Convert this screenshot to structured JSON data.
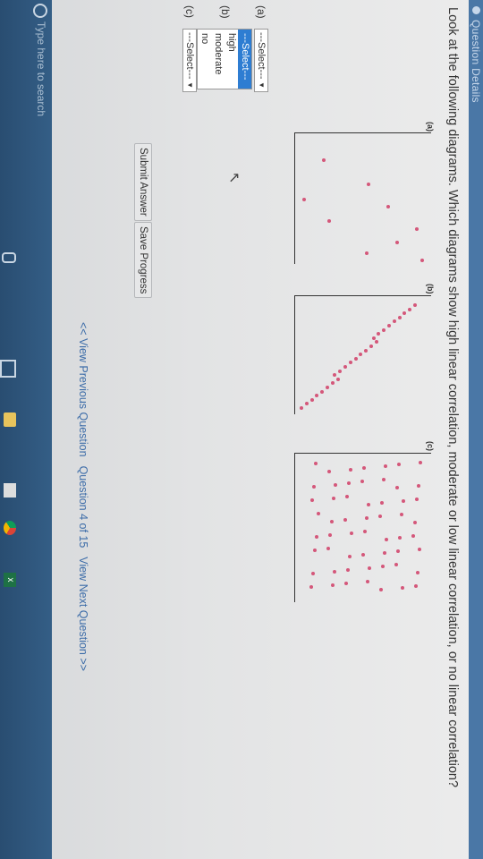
{
  "header": {
    "title": "Question Details"
  },
  "question": {
    "text": "Look at the following diagrams. Which diagrams show high linear correlation, moderate or low linear correlation, or no linear correlation?"
  },
  "diagrams": [
    {
      "label": "(a)"
    },
    {
      "label": "(b)"
    },
    {
      "label": "(c)"
    }
  ],
  "answers": {
    "rows": [
      {
        "letter": "(a)",
        "selected": "---Select---"
      },
      {
        "letter": "(b)"
      },
      {
        "letter": "(c)",
        "selected": "---Select---"
      }
    ],
    "dropdown_options": [
      "---Select---",
      "high",
      "moderate",
      "no"
    ]
  },
  "buttons": {
    "submit": "Submit Answer",
    "save": "Save Progress"
  },
  "nav": {
    "prev": "<< View Previous Question",
    "position": "Question 4 of 15",
    "next": "View Next Question >>"
  },
  "taskbar": {
    "search_placeholder": "Type here to search",
    "excel_label": "x"
  },
  "colors": {
    "header": "#4a77a6",
    "dot": "#d4577a",
    "link": "#3c6ca8",
    "highlight": "#2e7dd2",
    "taskbar": "#2f5a80"
  }
}
